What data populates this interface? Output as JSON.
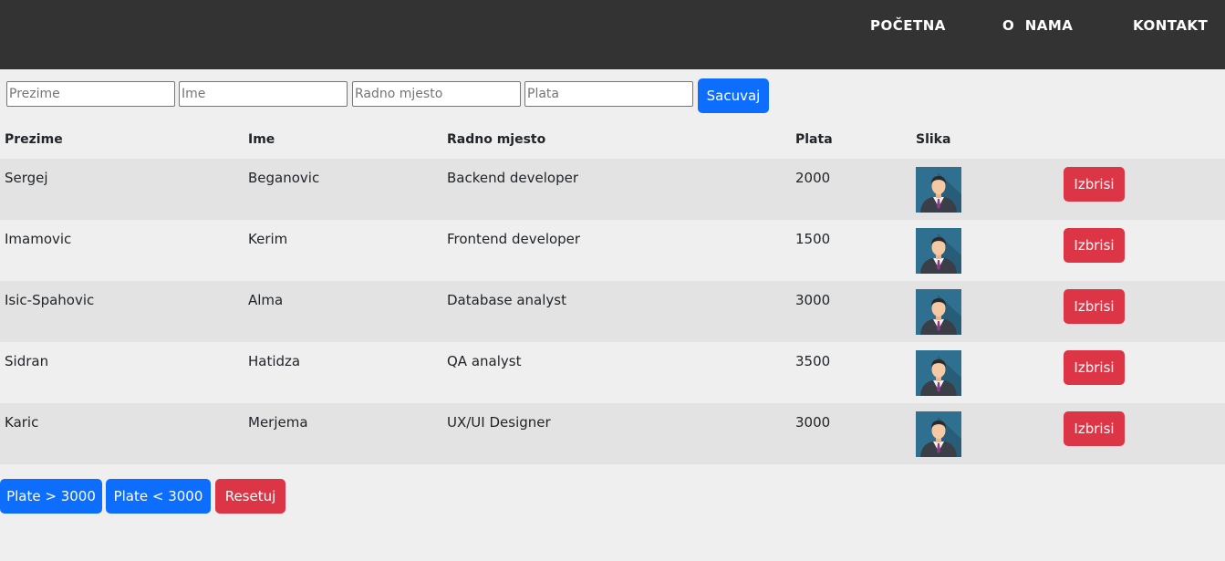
{
  "nav": {
    "items": [
      {
        "label": "POČETNA"
      },
      {
        "label": "O  NAMA"
      },
      {
        "label": "KONTAKT"
      }
    ]
  },
  "form": {
    "prezime_placeholder": "Prezime",
    "ime_placeholder": "Ime",
    "radno_mjesto_placeholder": "Radno mjesto",
    "plata_placeholder": "Plata",
    "save_label": "Sacuvaj"
  },
  "table": {
    "headers": [
      "Prezime",
      "Ime",
      "Radno mjesto",
      "Plata",
      "Slika"
    ],
    "rows": [
      {
        "prezime": "Sergej",
        "ime": "Beganovic",
        "radno_mjesto": "Backend developer",
        "plata": "2000",
        "delete_label": "Izbrisi"
      },
      {
        "prezime": "Imamovic",
        "ime": "Kerim",
        "radno_mjesto": "Frontend developer",
        "plata": "1500",
        "delete_label": "Izbrisi"
      },
      {
        "prezime": "Isic-Spahovic",
        "ime": "Alma",
        "radno_mjesto": "Database analyst",
        "plata": "3000",
        "delete_label": "Izbrisi"
      },
      {
        "prezime": "Sidran",
        "ime": "Hatidza",
        "radno_mjesto": "QA analyst",
        "plata": "3500",
        "delete_label": "Izbrisi"
      },
      {
        "prezime": "Karic",
        "ime": "Merjema",
        "radno_mjesto": "UX/UI Designer",
        "plata": "3000",
        "delete_label": "Izbrisi"
      }
    ]
  },
  "filters": {
    "gt_label": "Plate > 3000",
    "lt_label": "Plate < 3000",
    "reset_label": "Resetuj"
  },
  "colors": {
    "navbar": "#333333",
    "primary": "#0d6efd",
    "danger": "#dc3545",
    "background": "#efefef"
  },
  "icons": {
    "avatar": "user-avatar-icon"
  }
}
